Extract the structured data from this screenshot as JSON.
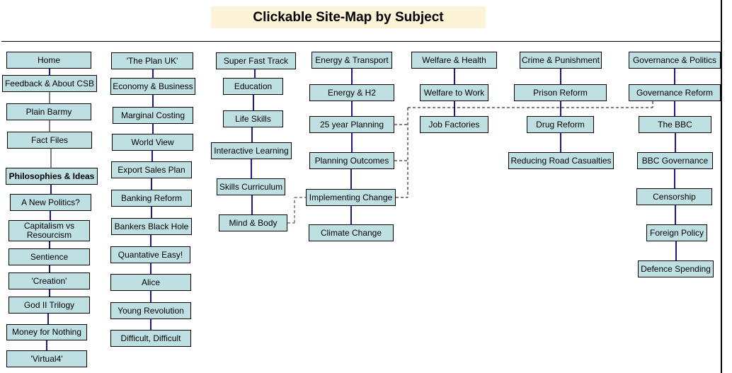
{
  "title": "Clickable Site-Map by Subject",
  "colors": {
    "node_fill": "#bfe0e3",
    "title_fill": "#fdf3d7",
    "connector": "#1a1a8c",
    "cross_link": "#000000"
  },
  "columns": [
    {
      "id": "col1",
      "nodes": [
        {
          "label": "Home"
        },
        {
          "label": "Feedback & About CSB"
        },
        {
          "label": "Plain Barmy"
        },
        {
          "label": "Fact Files"
        },
        {
          "label": "Philosophies & Ideas",
          "bold": true
        },
        {
          "label": "A New Politics?"
        },
        {
          "label": "Capitalism vs\nResourcism"
        },
        {
          "label": "Sentience"
        },
        {
          "label": "'Creation'"
        },
        {
          "label": "God II  Trilogy"
        },
        {
          "label": "Money for Nothing"
        },
        {
          "label": "'Virtual4'"
        }
      ]
    },
    {
      "id": "col2",
      "nodes": [
        {
          "label": "'The Plan UK'"
        },
        {
          "label": "Economy & Business"
        },
        {
          "label": "Marginal Costing"
        },
        {
          "label": "World View"
        },
        {
          "label": "Export Sales Plan"
        },
        {
          "label": "Banking Reform"
        },
        {
          "label": "Bankers Black Hole"
        },
        {
          "label": "Quantative Easy!"
        },
        {
          "label": "Alice"
        },
        {
          "label": "Young Revolution"
        },
        {
          "label": "Difficult, Difficult"
        }
      ]
    },
    {
      "id": "col3",
      "nodes": [
        {
          "label": "Super Fast Track"
        },
        {
          "label": "Education"
        },
        {
          "label": "Life Skills"
        },
        {
          "label": "Interactive Learning"
        },
        {
          "label": "Skills Curriculum"
        },
        {
          "label": "Mind & Body"
        }
      ]
    },
    {
      "id": "col4",
      "nodes": [
        {
          "label": "Energy & Transport"
        },
        {
          "label": "Energy & H2"
        },
        {
          "label": "25 year Planning"
        },
        {
          "label": "Planning Outcomes"
        },
        {
          "label": "Implementing Change"
        },
        {
          "label": "Climate Change"
        }
      ]
    },
    {
      "id": "col5",
      "nodes": [
        {
          "label": "Welfare & Health"
        },
        {
          "label": "Welfare to Work"
        },
        {
          "label": "Job Factories"
        }
      ]
    },
    {
      "id": "col6",
      "nodes": [
        {
          "label": "Crime & Punishment"
        },
        {
          "label": "Prison Reform"
        },
        {
          "label": "Drug Reform"
        },
        {
          "label": "Reducing Road Casualties"
        }
      ]
    },
    {
      "id": "col7",
      "nodes": [
        {
          "label": "Governance & Politics"
        },
        {
          "label": "Governance Reform"
        },
        {
          "label": "The BBC"
        },
        {
          "label": "BBC Governance"
        },
        {
          "label": "Censorship"
        },
        {
          "label": "Foreign Policy"
        },
        {
          "label": "Defence Spending"
        }
      ]
    }
  ],
  "cross_links": [
    {
      "from": "Mind & Body",
      "to": "Implementing Change"
    },
    {
      "from": "25 year Planning",
      "to": "Governance Reform"
    },
    {
      "from": "Planning Outcomes",
      "to": "Governance Reform"
    },
    {
      "from": "Implementing Change",
      "to": "Governance Reform"
    }
  ]
}
